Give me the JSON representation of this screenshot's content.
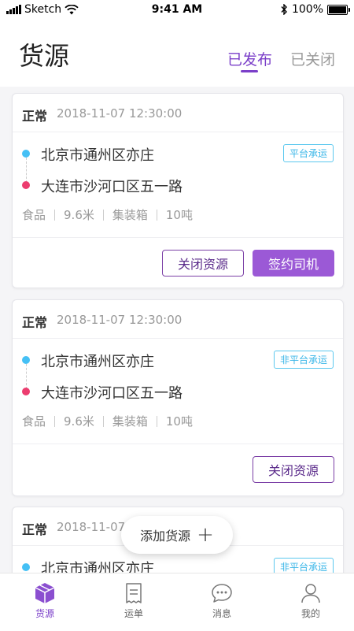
{
  "status_bar": {
    "carrier": "Sketch",
    "time": "9:41 AM",
    "battery": "100%"
  },
  "header": {
    "title": "货源",
    "tabs": [
      {
        "label": "已发布",
        "active": true
      },
      {
        "label": "已关闭",
        "active": false
      }
    ]
  },
  "colors": {
    "accent": "#7b3fc9",
    "button_fill": "#9b59d6",
    "from_dot": "#45c0f5",
    "to_dot": "#ec3d6f",
    "badge": "#39b6e8"
  },
  "cards": [
    {
      "status": "正常",
      "time": "2018-11-07 12:30:00",
      "from": "北京市通州区亦庄",
      "to": "大连市沙河口区五一路",
      "badge": "平台承运",
      "specs": [
        "食品",
        "9.6米",
        "集装箱",
        "10吨"
      ],
      "buttons": {
        "close": "关闭资源",
        "sign": "签约司机"
      }
    },
    {
      "status": "正常",
      "time": "2018-11-07 12:30:00",
      "from": "北京市通州区亦庄",
      "to": "大连市沙河口区五一路",
      "badge": "非平台承运",
      "specs": [
        "食品",
        "9.6米",
        "集装箱",
        "10吨"
      ],
      "buttons": {
        "close": "关闭资源"
      }
    },
    {
      "status": "正常",
      "time": "2018-11-07",
      "from": "北京市通州区亦庄",
      "badge": "非平台承运"
    }
  ],
  "fab": {
    "label": "添加货源"
  },
  "tabbar": {
    "items": [
      {
        "label": "货源",
        "icon": "box-icon",
        "active": true
      },
      {
        "label": "运单",
        "icon": "document-icon",
        "active": false
      },
      {
        "label": "消息",
        "icon": "chat-icon",
        "active": false
      },
      {
        "label": "我的",
        "icon": "user-icon",
        "active": false
      }
    ]
  }
}
